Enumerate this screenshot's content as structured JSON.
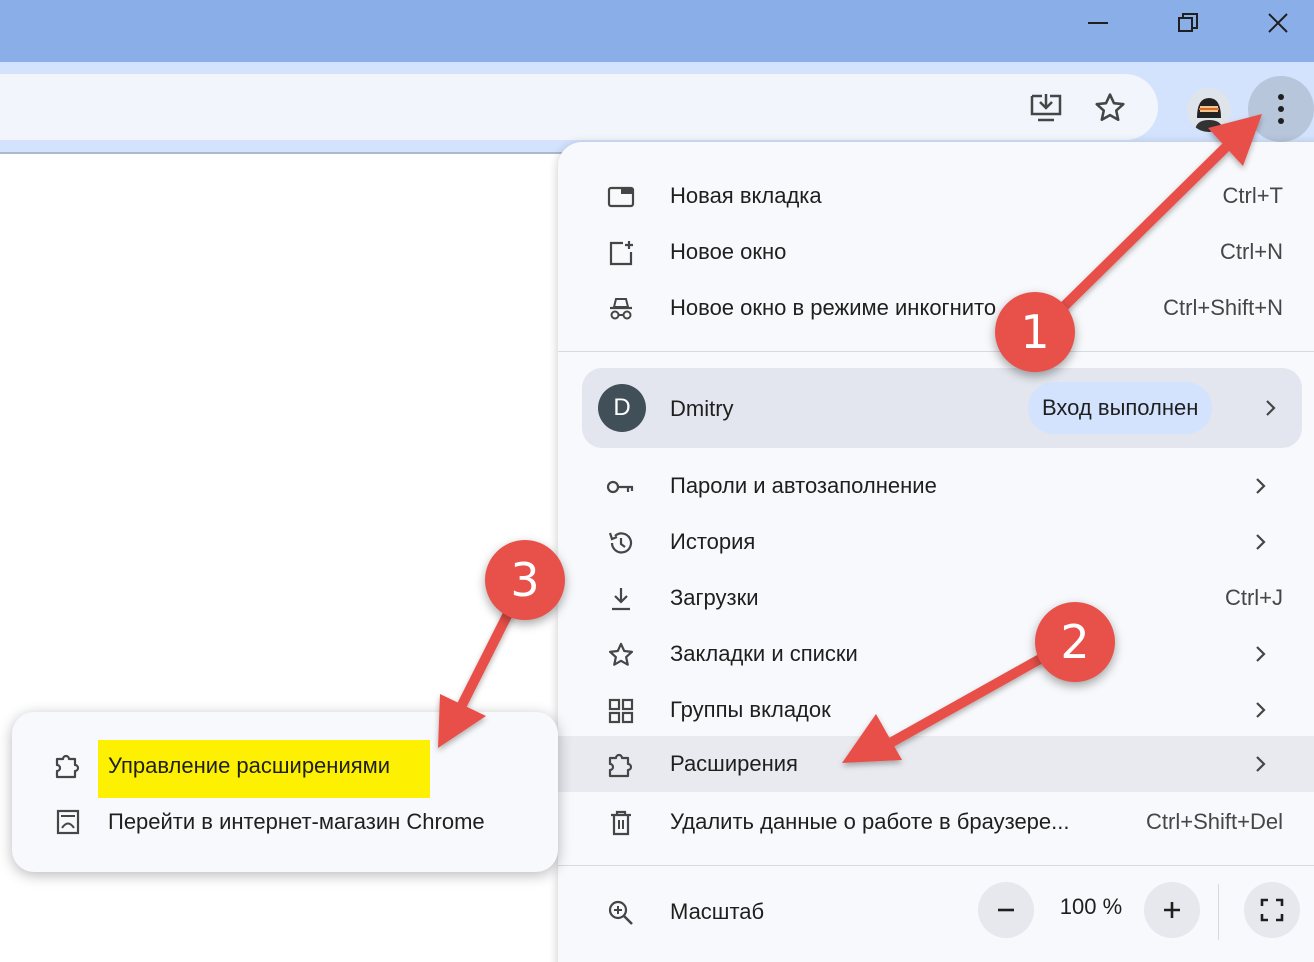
{
  "window": {
    "minimize_icon": "minimize-icon",
    "restore_icon": "restore-icon",
    "close_icon": "close-icon"
  },
  "toolbar": {
    "install_icon": "install-app-icon",
    "bookmark_icon": "star-icon",
    "profile_icon": "profile-avatar",
    "menu_icon": "kebab-menu-icon"
  },
  "menu": {
    "items_top": [
      {
        "label": "Новая вкладка",
        "shortcut": "Ctrl+T",
        "icon": "new-tab-icon"
      },
      {
        "label": "Новое окно",
        "shortcut": "Ctrl+N",
        "icon": "new-window-icon"
      },
      {
        "label": "Новое окно в режиме инкогнито",
        "shortcut": "Ctrl+Shift+N",
        "icon": "incognito-icon"
      }
    ],
    "profile": {
      "initial": "D",
      "name": "Dmitry",
      "status": "Вход выполнен"
    },
    "items_mid": [
      {
        "label": "Пароли и автозаполнение",
        "shortcut": "",
        "icon": "key-icon"
      },
      {
        "label": "История",
        "shortcut": "",
        "icon": "history-icon"
      },
      {
        "label": "Загрузки",
        "shortcut": "Ctrl+J",
        "icon": "download-icon"
      },
      {
        "label": "Закладки и списки",
        "shortcut": "",
        "icon": "star-icon"
      },
      {
        "label": "Группы вкладок",
        "shortcut": "",
        "icon": "grid-icon"
      },
      {
        "label": "Расширения",
        "shortcut": "",
        "icon": "puzzle-icon"
      },
      {
        "label": "Удалить данные о работе в браузере...",
        "shortcut": "Ctrl+Shift+Del",
        "icon": "trash-icon"
      }
    ],
    "zoom": {
      "label": "Масштаб",
      "value": "100 %",
      "icon": "zoom-icon"
    }
  },
  "submenu": {
    "items": [
      {
        "label": "Управление расширениями",
        "icon": "puzzle-icon"
      },
      {
        "label": "Перейти в интернет-магазин Chrome",
        "icon": "web-store-icon"
      }
    ]
  },
  "callouts": [
    "1",
    "2",
    "3"
  ],
  "colors": {
    "titlebar": "#8aaee8",
    "toolbar": "#d3e3fd",
    "callout": "#e8504a",
    "highlight": "#fdf000",
    "avatar": "#414f58"
  }
}
